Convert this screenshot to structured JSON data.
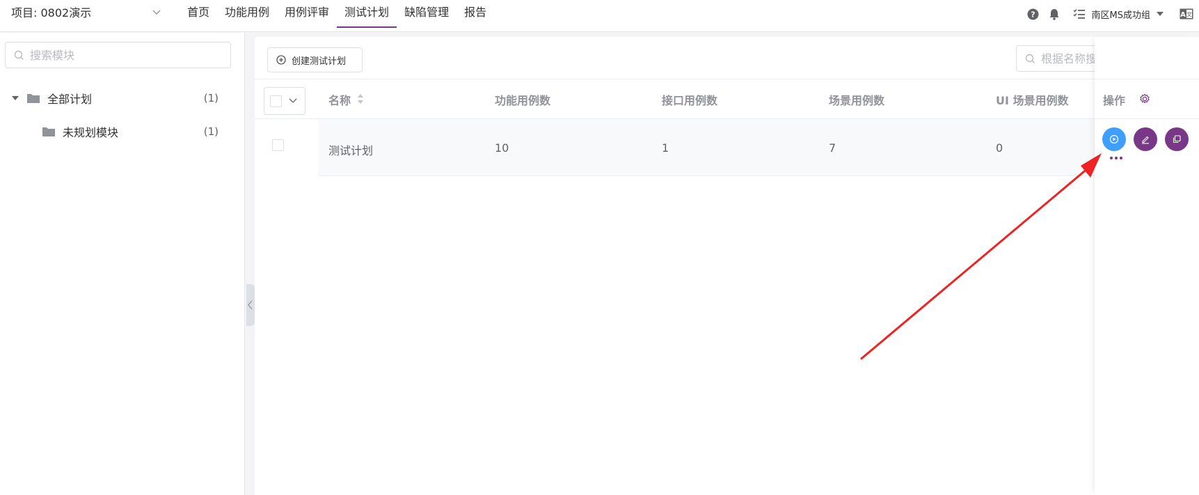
{
  "topbar": {
    "project_label": "项目: 0802演示",
    "nav": [
      "首页",
      "功能用例",
      "用例评审",
      "测试计划",
      "缺陷管理",
      "报告"
    ],
    "active_nav": "测试计划",
    "workspace": "南区MS成功组",
    "icons": [
      "help-icon",
      "bell-icon",
      "task-list-icon",
      "language-icon"
    ]
  },
  "sidebar": {
    "search_placeholder": "搜索模块",
    "tree": [
      {
        "label": "全部计划",
        "count": "(1)"
      },
      {
        "label": "未规划模块",
        "count": "(1)"
      }
    ]
  },
  "main": {
    "create_label": "创建测试计划",
    "search_placeholder": "根据名称搜索",
    "columns": [
      "名称",
      "功能用例数",
      "接口用例数",
      "场景用例数",
      "UI 场景用例数",
      "操作"
    ],
    "rows": [
      {
        "name": "测试计划",
        "functional": "10",
        "api": "1",
        "scenario": "7",
        "ui_scenario": "0"
      }
    ],
    "colors": {
      "accent": "#783887",
      "run": "#409eff"
    }
  }
}
